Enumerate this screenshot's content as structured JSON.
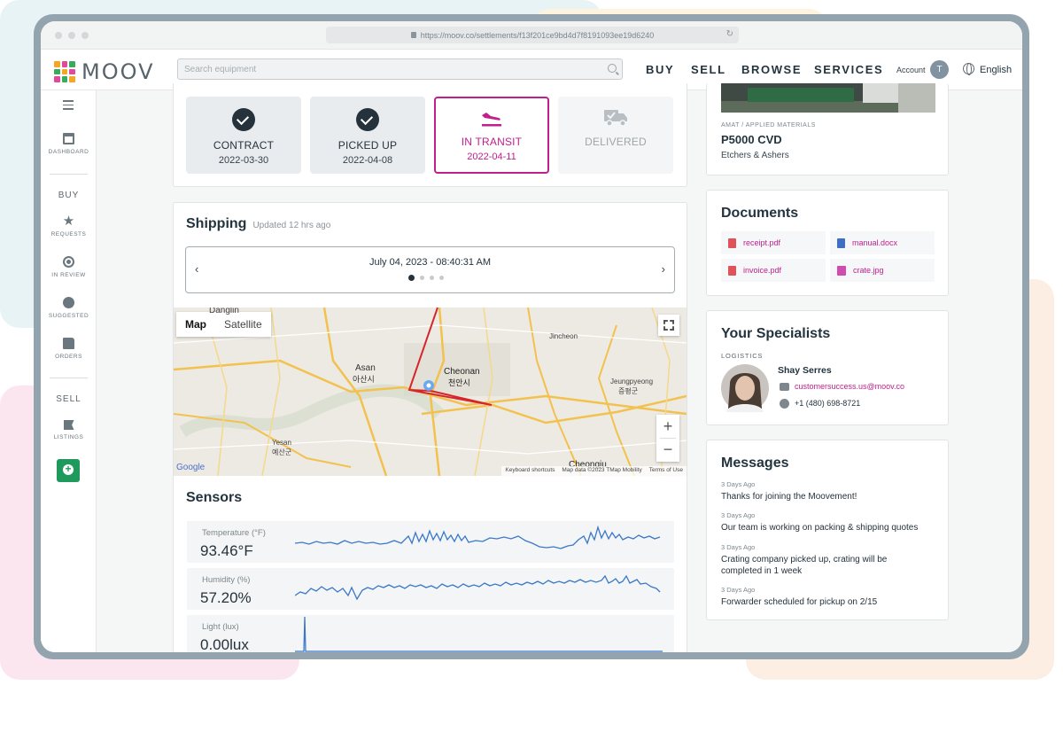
{
  "browser": {
    "url": "https://moov.co/settlements/f13f201ce9bd4d7f8191093ee19d6240"
  },
  "header": {
    "logo_text": "MOOV",
    "search_placeholder": "Search equipment",
    "nav": [
      "BUY",
      "SELL",
      "BROWSE",
      "SERVICES"
    ],
    "account_label": "Account",
    "avatar_initial": "T",
    "language": "English"
  },
  "sidebar": {
    "dashboard": "DASHBOARD",
    "buy_section": "BUY",
    "requests": "REQUESTS",
    "in_review": "IN REVIEW",
    "suggested": "SUGGESTED",
    "orders": "ORDERS",
    "sell_section": "SELL",
    "listings": "LISTINGS"
  },
  "status_steps": [
    {
      "label": "CONTRACT",
      "date": "2022-03-30",
      "state": "done"
    },
    {
      "label": "PICKED UP",
      "date": "2022-04-08",
      "state": "done"
    },
    {
      "label": "IN TRANSIT",
      "date": "2022-04-11",
      "state": "active"
    },
    {
      "label": "DELIVERED",
      "date": "",
      "state": "pending"
    }
  ],
  "shipping": {
    "title": "Shipping",
    "updated": "Updated 12 hrs ago",
    "timestamp": "July 04, 2023 - 08:40:31 AM",
    "map_tab": "Map",
    "satellite_tab": "Satellite",
    "map_labels": {
      "danglin": "Danglin",
      "asan": "Asan",
      "asan_kr": "아산시",
      "cheonan": "Cheonan",
      "cheonan_kr": "천안시",
      "jincheon": "Jincheon",
      "jeungpyeong": "Jeungpyeong",
      "jeungpyeong_kr": "증평군",
      "yesan": "Yesan",
      "yesan_kr": "예산군",
      "cheongju": "Cheongju",
      "google": "Google"
    },
    "attribution": [
      "Keyboard shortcuts",
      "Map data ©2023 TMap Mobility",
      "Terms of Use"
    ]
  },
  "sensors": {
    "title": "Sensors",
    "items": [
      {
        "label": "Temperature (°F)",
        "value": "93.46°F"
      },
      {
        "label": "Humidity (%)",
        "value": "57.20%"
      },
      {
        "label": "Light (lux)",
        "value": "0.00lux"
      }
    ]
  },
  "equipment": {
    "maker": "AMAT / APPLIED MATERIALS",
    "model": "P5000 CVD",
    "category": "Etchers & Ashers"
  },
  "documents": {
    "title": "Documents",
    "files": [
      {
        "name": "receipt.pdf",
        "type": "pdf"
      },
      {
        "name": "manual.docx",
        "type": "docx"
      },
      {
        "name": "invoice.pdf",
        "type": "pdf"
      },
      {
        "name": "crate.jpg",
        "type": "jpg"
      }
    ]
  },
  "specialists": {
    "title": "Your Specialists",
    "role": "LOGISTICS",
    "name": "Shay Serres",
    "email": "customersuccess.us@moov.co",
    "phone": "+1 (480) 698-8721"
  },
  "messages": {
    "title": "Messages",
    "items": [
      {
        "time": "3 Days Ago",
        "text": "Thanks for joining the Moovement!"
      },
      {
        "time": "3 Days Ago",
        "text": "Our team is working on packing & shipping quotes"
      },
      {
        "time": "3 Days Ago",
        "text": "Crating company picked up, crating will be completed in 1 week"
      },
      {
        "time": "3 Days Ago",
        "text": "Forwarder scheduled for pickup on 2/15"
      }
    ]
  },
  "colors": {
    "accent": "#c01f8c",
    "dark": "#25323c",
    "green": "#1f9a5c",
    "chart_line": "#3b78c7"
  }
}
